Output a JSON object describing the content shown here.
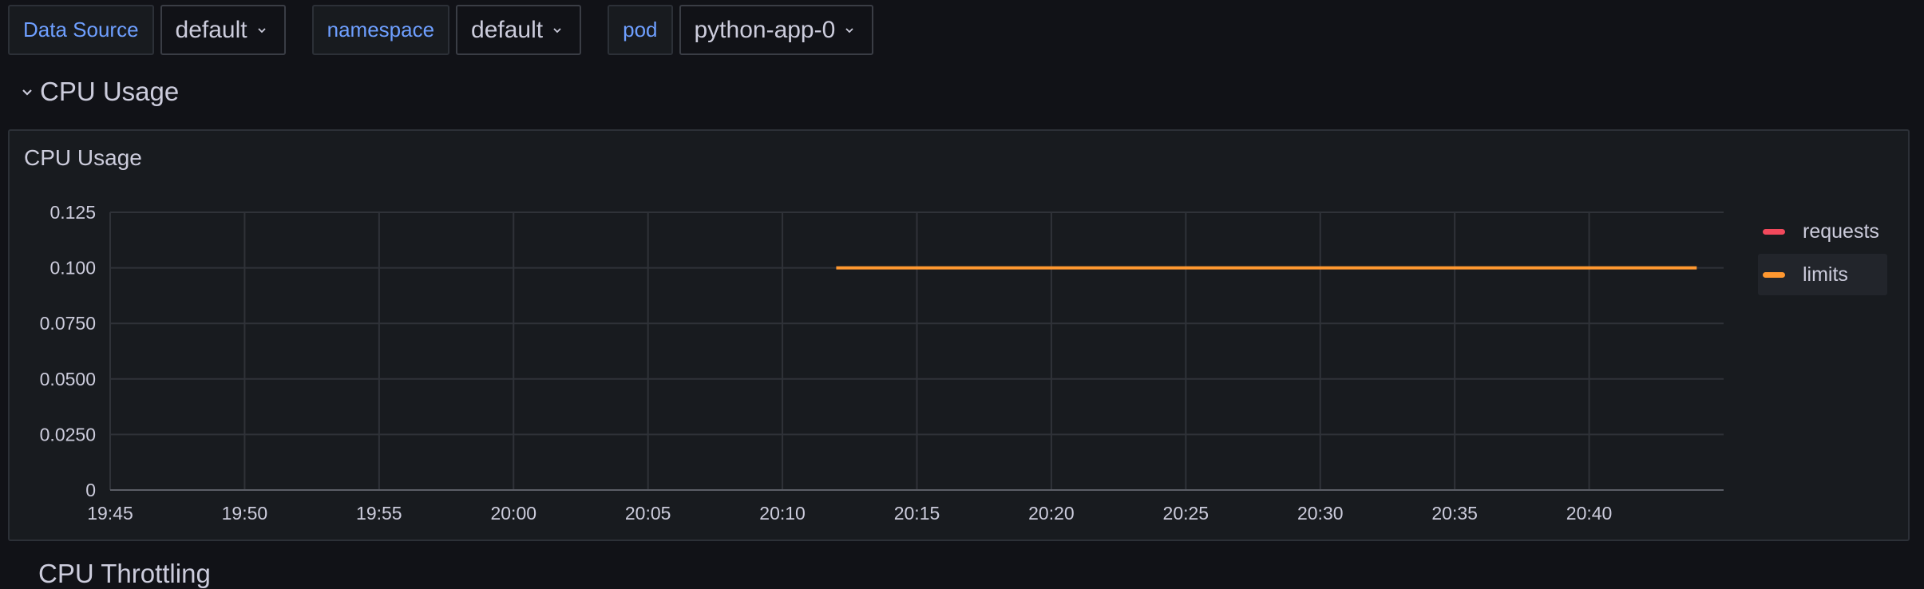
{
  "variables": [
    {
      "label": "Data Source",
      "value": "default"
    },
    {
      "label": "namespace",
      "value": "default"
    },
    {
      "label": "pod",
      "value": "python-app-0"
    }
  ],
  "row": {
    "title": "CPU Usage"
  },
  "panel": {
    "title": "CPU Usage"
  },
  "next_row": {
    "title": "CPU Throttling"
  },
  "colors": {
    "requests": "#f2495c",
    "limits": "#ff9830",
    "grid": "#2f3238",
    "axis": "#5b5e66"
  },
  "chart_data": {
    "type": "line",
    "title": "CPU Usage",
    "x_ticks": [
      "19:45",
      "19:50",
      "19:55",
      "20:00",
      "20:05",
      "20:10",
      "20:15",
      "20:20",
      "20:25",
      "20:30",
      "20:35",
      "20:40"
    ],
    "y_ticks": [
      "0",
      "0.0250",
      "0.0500",
      "0.0750",
      "0.100",
      "0.125"
    ],
    "xlim": [
      "19:45",
      "20:45"
    ],
    "ylim": [
      0,
      0.125
    ],
    "grid": true,
    "legend_position": "right",
    "series": [
      {
        "name": "requests",
        "x": [],
        "y": []
      },
      {
        "name": "limits",
        "x": [
          "20:12",
          "20:44"
        ],
        "y": [
          0.1,
          0.1
        ]
      }
    ]
  }
}
